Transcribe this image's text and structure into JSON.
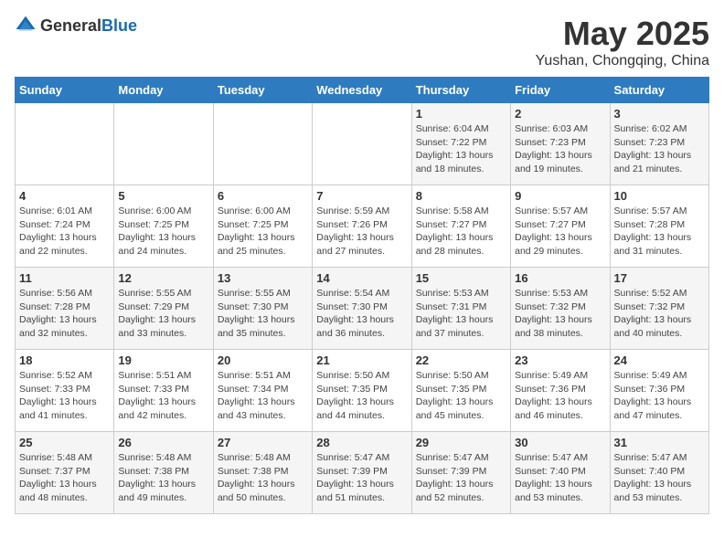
{
  "logo": {
    "text_general": "General",
    "text_blue": "Blue"
  },
  "title": "May 2025",
  "subtitle": "Yushan, Chongqing, China",
  "days_of_week": [
    "Sunday",
    "Monday",
    "Tuesday",
    "Wednesday",
    "Thursday",
    "Friday",
    "Saturday"
  ],
  "weeks": [
    [
      {
        "day": "",
        "info": ""
      },
      {
        "day": "",
        "info": ""
      },
      {
        "day": "",
        "info": ""
      },
      {
        "day": "",
        "info": ""
      },
      {
        "day": "1",
        "info": "Sunrise: 6:04 AM\nSunset: 7:22 PM\nDaylight: 13 hours\nand 18 minutes."
      },
      {
        "day": "2",
        "info": "Sunrise: 6:03 AM\nSunset: 7:23 PM\nDaylight: 13 hours\nand 19 minutes."
      },
      {
        "day": "3",
        "info": "Sunrise: 6:02 AM\nSunset: 7:23 PM\nDaylight: 13 hours\nand 21 minutes."
      }
    ],
    [
      {
        "day": "4",
        "info": "Sunrise: 6:01 AM\nSunset: 7:24 PM\nDaylight: 13 hours\nand 22 minutes."
      },
      {
        "day": "5",
        "info": "Sunrise: 6:00 AM\nSunset: 7:25 PM\nDaylight: 13 hours\nand 24 minutes."
      },
      {
        "day": "6",
        "info": "Sunrise: 6:00 AM\nSunset: 7:25 PM\nDaylight: 13 hours\nand 25 minutes."
      },
      {
        "day": "7",
        "info": "Sunrise: 5:59 AM\nSunset: 7:26 PM\nDaylight: 13 hours\nand 27 minutes."
      },
      {
        "day": "8",
        "info": "Sunrise: 5:58 AM\nSunset: 7:27 PM\nDaylight: 13 hours\nand 28 minutes."
      },
      {
        "day": "9",
        "info": "Sunrise: 5:57 AM\nSunset: 7:27 PM\nDaylight: 13 hours\nand 29 minutes."
      },
      {
        "day": "10",
        "info": "Sunrise: 5:57 AM\nSunset: 7:28 PM\nDaylight: 13 hours\nand 31 minutes."
      }
    ],
    [
      {
        "day": "11",
        "info": "Sunrise: 5:56 AM\nSunset: 7:28 PM\nDaylight: 13 hours\nand 32 minutes."
      },
      {
        "day": "12",
        "info": "Sunrise: 5:55 AM\nSunset: 7:29 PM\nDaylight: 13 hours\nand 33 minutes."
      },
      {
        "day": "13",
        "info": "Sunrise: 5:55 AM\nSunset: 7:30 PM\nDaylight: 13 hours\nand 35 minutes."
      },
      {
        "day": "14",
        "info": "Sunrise: 5:54 AM\nSunset: 7:30 PM\nDaylight: 13 hours\nand 36 minutes."
      },
      {
        "day": "15",
        "info": "Sunrise: 5:53 AM\nSunset: 7:31 PM\nDaylight: 13 hours\nand 37 minutes."
      },
      {
        "day": "16",
        "info": "Sunrise: 5:53 AM\nSunset: 7:32 PM\nDaylight: 13 hours\nand 38 minutes."
      },
      {
        "day": "17",
        "info": "Sunrise: 5:52 AM\nSunset: 7:32 PM\nDaylight: 13 hours\nand 40 minutes."
      }
    ],
    [
      {
        "day": "18",
        "info": "Sunrise: 5:52 AM\nSunset: 7:33 PM\nDaylight: 13 hours\nand 41 minutes."
      },
      {
        "day": "19",
        "info": "Sunrise: 5:51 AM\nSunset: 7:33 PM\nDaylight: 13 hours\nand 42 minutes."
      },
      {
        "day": "20",
        "info": "Sunrise: 5:51 AM\nSunset: 7:34 PM\nDaylight: 13 hours\nand 43 minutes."
      },
      {
        "day": "21",
        "info": "Sunrise: 5:50 AM\nSunset: 7:35 PM\nDaylight: 13 hours\nand 44 minutes."
      },
      {
        "day": "22",
        "info": "Sunrise: 5:50 AM\nSunset: 7:35 PM\nDaylight: 13 hours\nand 45 minutes."
      },
      {
        "day": "23",
        "info": "Sunrise: 5:49 AM\nSunset: 7:36 PM\nDaylight: 13 hours\nand 46 minutes."
      },
      {
        "day": "24",
        "info": "Sunrise: 5:49 AM\nSunset: 7:36 PM\nDaylight: 13 hours\nand 47 minutes."
      }
    ],
    [
      {
        "day": "25",
        "info": "Sunrise: 5:48 AM\nSunset: 7:37 PM\nDaylight: 13 hours\nand 48 minutes."
      },
      {
        "day": "26",
        "info": "Sunrise: 5:48 AM\nSunset: 7:38 PM\nDaylight: 13 hours\nand 49 minutes."
      },
      {
        "day": "27",
        "info": "Sunrise: 5:48 AM\nSunset: 7:38 PM\nDaylight: 13 hours\nand 50 minutes."
      },
      {
        "day": "28",
        "info": "Sunrise: 5:47 AM\nSunset: 7:39 PM\nDaylight: 13 hours\nand 51 minutes."
      },
      {
        "day": "29",
        "info": "Sunrise: 5:47 AM\nSunset: 7:39 PM\nDaylight: 13 hours\nand 52 minutes."
      },
      {
        "day": "30",
        "info": "Sunrise: 5:47 AM\nSunset: 7:40 PM\nDaylight: 13 hours\nand 53 minutes."
      },
      {
        "day": "31",
        "info": "Sunrise: 5:47 AM\nSunset: 7:40 PM\nDaylight: 13 hours\nand 53 minutes."
      }
    ]
  ]
}
